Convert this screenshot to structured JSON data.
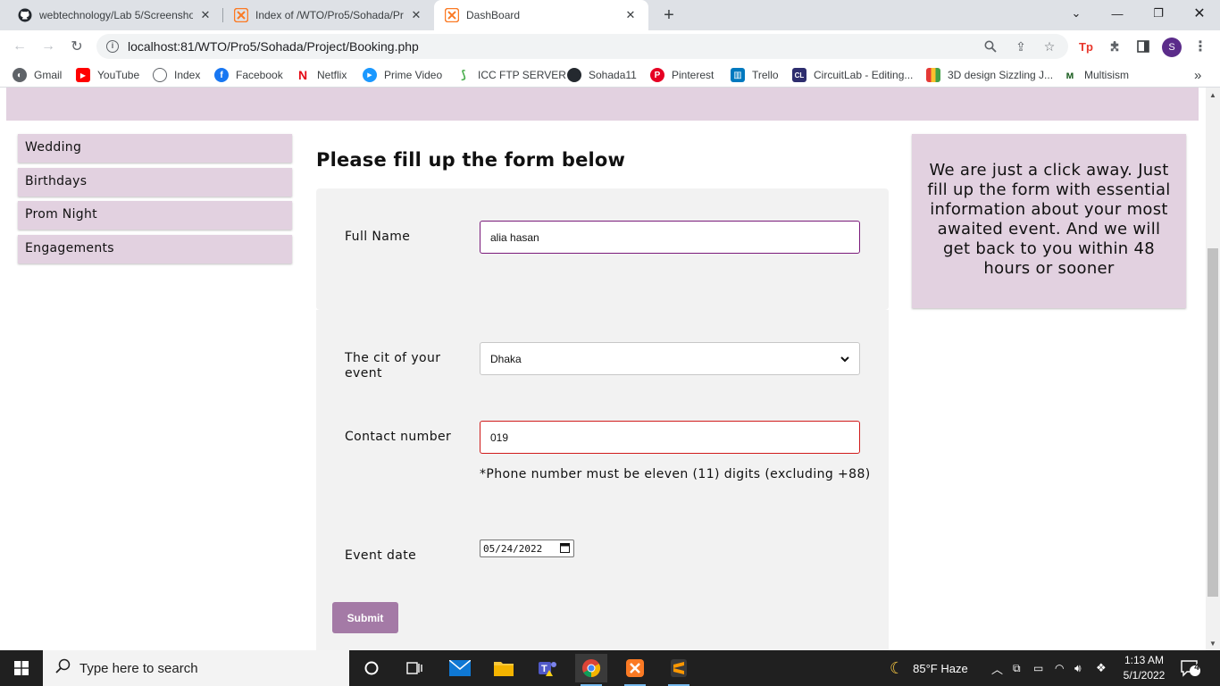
{
  "browser": {
    "tabs": [
      {
        "title": "webtechnology/Lab 5/Screensho",
        "icon": "github-icon",
        "active": false
      },
      {
        "title": "Index of /WTO/Pro5/Sohada/Pro",
        "icon": "xampp-icon",
        "active": false
      },
      {
        "title": "DashBoard",
        "icon": "xampp-icon",
        "active": true
      }
    ],
    "url": "localhost:81/WTO/Pro5/Sohada/Project/Booking.php",
    "profile_initial": "S",
    "bookmarks": [
      {
        "label": "Gmail",
        "icon": "gmail-icon"
      },
      {
        "label": "YouTube",
        "icon": "youtube-icon"
      },
      {
        "label": "Index",
        "icon": "globe-icon"
      },
      {
        "label": "Facebook",
        "icon": "facebook-icon"
      },
      {
        "label": "Netflix",
        "icon": "netflix-icon"
      },
      {
        "label": "Prime Video",
        "icon": "prime-video-icon"
      },
      {
        "label": "ICC FTP SERVER",
        "icon": "icc-icon"
      },
      {
        "label": "Sohada11",
        "icon": "github-icon"
      },
      {
        "label": "Pinterest",
        "icon": "pinterest-icon"
      },
      {
        "label": "Trello",
        "icon": "trello-icon"
      },
      {
        "label": "CircuitLab - Editing...",
        "icon": "circuitlab-icon"
      },
      {
        "label": "3D design Sizzling J...",
        "icon": "tinkercad-icon"
      },
      {
        "label": "Multisism",
        "icon": "multisim-icon"
      }
    ]
  },
  "sidebar": {
    "items": [
      {
        "label": "Wedding"
      },
      {
        "label": "Birthdays"
      },
      {
        "label": "Prom Night"
      },
      {
        "label": "Engagements"
      }
    ]
  },
  "form": {
    "heading": "Please fill up the form below",
    "full_name": {
      "label": "Full Name",
      "value": "alia hasan"
    },
    "city": {
      "label": "The cit of your event",
      "value": "Dhaka"
    },
    "contact": {
      "label": "Contact number",
      "value": "019",
      "hint": "*Phone number must be eleven (11) digits (excluding +88)"
    },
    "event_date": {
      "label": "Event date",
      "value": "05/24/2022"
    },
    "submit_label": "Submit"
  },
  "info_box": {
    "text": "We are just a click away. Just fill up the form with essential information about your most awaited event. And we will get back to you within 48 hours or sooner"
  },
  "colors": {
    "accent_lilac": "#e2d1e0",
    "submit_purple": "#a47aa6",
    "name_border": "#7a1a7a",
    "error_red": "#d01b1b"
  },
  "taskbar": {
    "search_placeholder": "Type here to search",
    "weather": "85°F  Haze",
    "time": "1:13 AM",
    "date": "5/1/2022",
    "notification_count": "4"
  }
}
